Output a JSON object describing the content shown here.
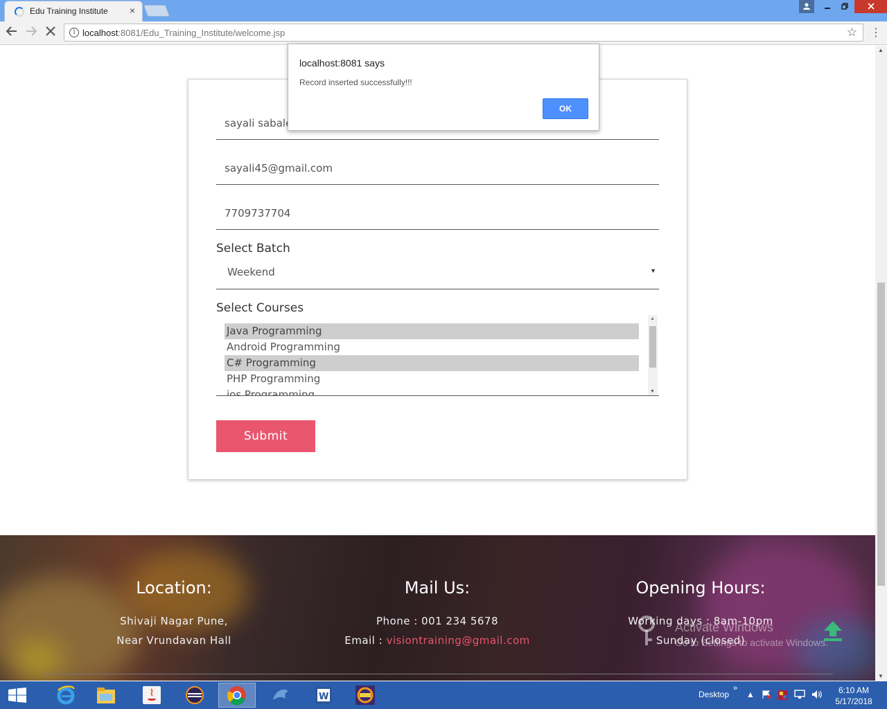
{
  "browser": {
    "tab_title": "Edu Training Institute",
    "tab_close": "×",
    "url_host": "localhost",
    "url_rest": ":8081/Edu_Training_Institute/welcome.jsp",
    "window_user_glyph": "👤"
  },
  "form": {
    "name_value": "sayali sabale",
    "email_value": "sayali45@gmail.com",
    "phone_value": "7709737704",
    "batch_label": "Select Batch",
    "batch_value": "Weekend",
    "courses_label": "Select Courses",
    "courses": [
      {
        "label": "Java Programming",
        "selected": true
      },
      {
        "label": "Android Programming",
        "selected": false
      },
      {
        "label": "C# Programming",
        "selected": true
      },
      {
        "label": "PHP Programming",
        "selected": false
      },
      {
        "label": "ios Programming",
        "selected": false
      }
    ],
    "submit_label": "Submit"
  },
  "alert": {
    "title": "localhost:8081 says",
    "message": "Record inserted successfully!!!",
    "ok_label": "OK"
  },
  "footer": {
    "location_heading": "Location:",
    "location_line1": "Shivaji Nagar Pune,",
    "location_line2": "Near Vrundavan Hall",
    "mail_heading": "Mail Us:",
    "phone_line": "Phone : 001 234 5678",
    "email_prefix": "Email : ",
    "email_link": "visiontraining@gmail.com",
    "hours_heading": "Opening Hours:",
    "working_days": "Working days : 8am-10pm",
    "sunday": "Sunday (closed)",
    "link_color": "#e9566e"
  },
  "watermark": {
    "line1": "Activate Windows",
    "line2": "Go to Settings to activate Windows."
  },
  "taskbar": {
    "desktop_label": "Desktop",
    "chevron": "»",
    "time": "6:10 AM",
    "date": "5/17/2018",
    "pinned": [
      "internet-explorer-icon",
      "file-explorer-icon",
      "java-icon",
      "eclipse-icon",
      "chrome-icon",
      "mysql-dolphin-icon",
      "word-icon",
      "java-ee-ide-icon"
    ],
    "active_app": "chrome-icon"
  },
  "colors": {
    "accent": "#e9566e",
    "browser_frame": "#6fa7ef",
    "taskbar": "#2b5fad",
    "ok_button": "#4d90fe"
  }
}
